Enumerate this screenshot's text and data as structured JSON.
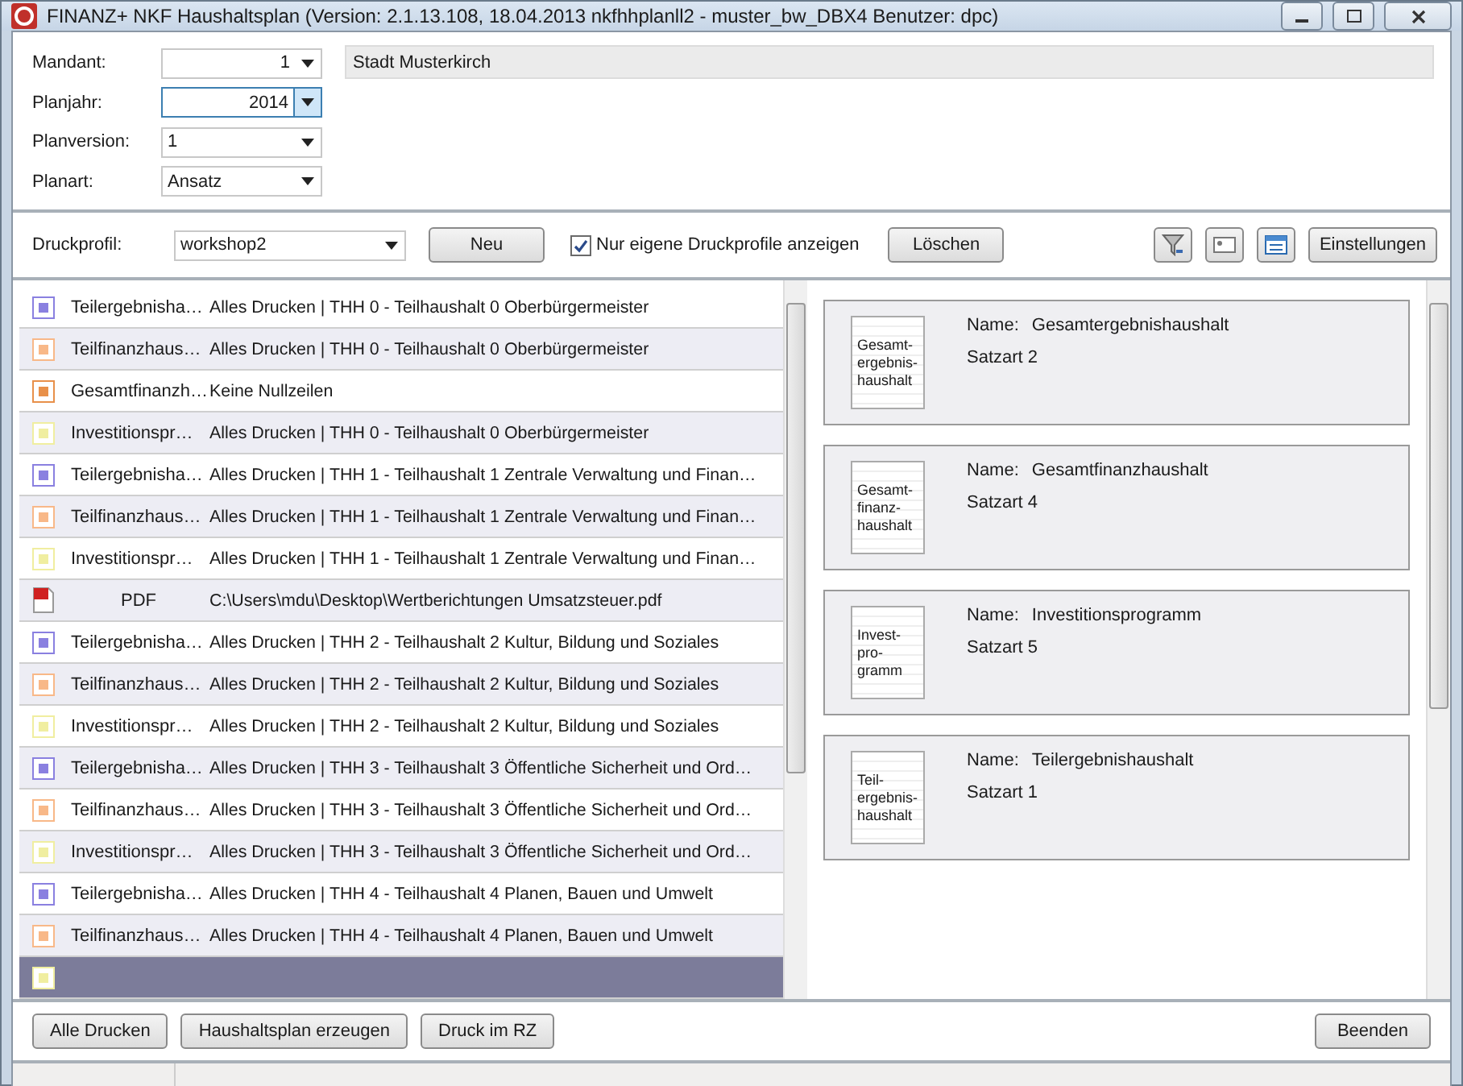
{
  "window": {
    "title": "FINANZ+ NKF Haushaltsplan (Version: 2.1.13.108, 18.04.2013 nkfhhplanll2 - muster_bw_DBX4 Benutzer: dpc)"
  },
  "form": {
    "fields": [
      {
        "label": "Mandant:",
        "value": "1",
        "kind": "numeric",
        "focused": false
      },
      {
        "label": "Planjahr:",
        "value": "2014",
        "kind": "numeric",
        "focused": true
      },
      {
        "label": "Planversion:",
        "value": "1",
        "kind": "choice",
        "focused": false
      },
      {
        "label": "Planart:",
        "value": "Ansatz",
        "kind": "choice",
        "focused": false
      }
    ],
    "mandant_name": "Stadt Musterkirch"
  },
  "profile_bar": {
    "label": "Druckprofil:",
    "value": "workshop2",
    "new_button": "Neu",
    "own_only": {
      "label": "Nur eigene Druckprofile anzeigen",
      "checked": true
    },
    "delete_button": "Löschen",
    "settings_button": "Einstellungen"
  },
  "list": {
    "rows": [
      {
        "kind": "square",
        "color": "#8a80e0",
        "name": "Teilergebnisha…",
        "description": "Alles Drucken | THH 0 - Teilhaushalt 0 Oberbürgermeister",
        "selected": false
      },
      {
        "kind": "square",
        "color": "#f8b888",
        "name": "Teilfinanzhaus…",
        "description": "Alles Drucken | THH 0 - Teilhaushalt 0 Oberbürgermeister",
        "selected": false
      },
      {
        "kind": "square",
        "color": "#e8904a",
        "name": "Gesamtfinanzh…",
        "description": "Keine Nullzeilen",
        "selected": false
      },
      {
        "kind": "square",
        "color": "#f0eea0",
        "name": "Investitionspr…",
        "description": "Alles Drucken | THH 0 - Teilhaushalt 0 Oberbürgermeister",
        "selected": false
      },
      {
        "kind": "square",
        "color": "#8a80e0",
        "name": "Teilergebnisha…",
        "description": "Alles Drucken | THH 1 - Teilhaushalt 1 Zentrale Verwaltung und Finan…",
        "selected": false
      },
      {
        "kind": "square",
        "color": "#f8b888",
        "name": "Teilfinanzhaus…",
        "description": "Alles Drucken | THH 1 - Teilhaushalt 1 Zentrale Verwaltung und Finan…",
        "selected": false
      },
      {
        "kind": "square",
        "color": "#f0eea0",
        "name": "Investitionspr…",
        "description": "Alles Drucken | THH 1 - Teilhaushalt 1 Zentrale Verwaltung und Finan…",
        "selected": false
      },
      {
        "kind": "pdf",
        "name": "PDF",
        "description": "C:\\Users\\mdu\\Desktop\\Wertberichtungen Umsatzsteuer.pdf",
        "selected": false
      },
      {
        "kind": "square",
        "color": "#8a80e0",
        "name": "Teilergebnisha…",
        "description": "Alles Drucken | THH 2 - Teilhaushalt 2 Kultur, Bildung und Soziales",
        "selected": false
      },
      {
        "kind": "square",
        "color": "#f8b888",
        "name": "Teilfinanzhaus…",
        "description": "Alles Drucken | THH 2 - Teilhaushalt 2 Kultur, Bildung und Soziales",
        "selected": false
      },
      {
        "kind": "square",
        "color": "#f0eea0",
        "name": "Investitionspr…",
        "description": "Alles Drucken | THH 2 - Teilhaushalt 2 Kultur, Bildung und Soziales",
        "selected": false
      },
      {
        "kind": "square",
        "color": "#8a80e0",
        "name": "Teilergebnisha…",
        "description": "Alles Drucken | THH 3 - Teilhaushalt 3 Öffentliche Sicherheit und Ord…",
        "selected": false
      },
      {
        "kind": "square",
        "color": "#f8b888",
        "name": "Teilfinanzhaus…",
        "description": "Alles Drucken | THH 3 - Teilhaushalt 3 Öffentliche Sicherheit und Ord…",
        "selected": false
      },
      {
        "kind": "square",
        "color": "#f0eea0",
        "name": "Investitionspr…",
        "description": "Alles Drucken | THH 3 - Teilhaushalt 3 Öffentliche Sicherheit und Ord…",
        "selected": false
      },
      {
        "kind": "square",
        "color": "#8a80e0",
        "name": "Teilergebnisha…",
        "description": "Alles Drucken | THH 4 - Teilhaushalt 4 Planen, Bauen und Umwelt",
        "selected": false
      },
      {
        "kind": "square",
        "color": "#f8b888",
        "name": "Teilfinanzhaus…",
        "description": "Alles Drucken | THH 4 - Teilhaushalt 4 Planen, Bauen und Umwelt",
        "selected": false
      },
      {
        "kind": "square",
        "color": "#f0eea0",
        "selected": true
      }
    ]
  },
  "cards": [
    {
      "icon_lines": [
        "Gesamt-",
        "ergebnis-",
        "haushalt"
      ],
      "name_label": "Name:",
      "name": "Gesamtergebnishaushalt",
      "record_type": "Satzart 2"
    },
    {
      "icon_lines": [
        "Gesamt-",
        "finanz-",
        "haushalt"
      ],
      "name_label": "Name:",
      "name": "Gesamtfinanzhaushalt",
      "record_type": "Satzart 4"
    },
    {
      "icon_lines": [
        "Invest-",
        "pro-",
        "gramm"
      ],
      "name_label": "Name:",
      "name": "Investitionsprogramm",
      "record_type": "Satzart 5"
    },
    {
      "icon_lines": [
        "Teil-",
        "ergebnis-",
        "haushalt"
      ],
      "name_label": "Name:",
      "name": "Teilergebnishaushalt",
      "record_type": "Satzart 1"
    }
  ],
  "bottom_buttons": [
    "Alle Drucken",
    "Haushaltsplan erzeugen",
    "Druck im RZ"
  ],
  "close_button": "Beenden"
}
